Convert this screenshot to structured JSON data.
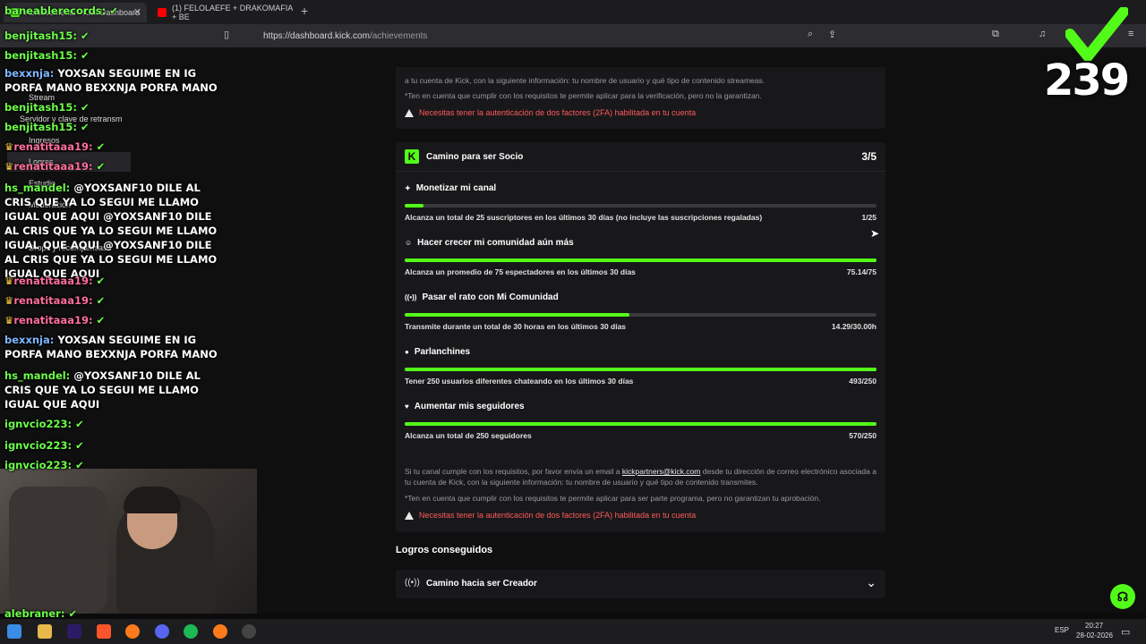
{
  "browser": {
    "tabs": [
      {
        "label": "Achievements - Kick Dashboard"
      },
      {
        "label": "(1) FELOLAEFE + DRAKOMAFIA + BE"
      }
    ],
    "url_host": "https://dashboard.kick.com",
    "url_path": "/achievements",
    "new_tab": "+"
  },
  "sidebar": {
    "items": [
      {
        "label": "Stream"
      },
      {
        "label": "Servidor y clave de retransm"
      },
      {
        "label": "Ingresos"
      },
      {
        "label": "Logros"
      },
      {
        "label": "Estudio"
      },
      {
        "label": "Moderación"
      },
      {
        "label": "Drops y recompensas"
      }
    ]
  },
  "top_card": {
    "text_partial": "a tu cuenta de Kick, con la siguiente información: tu nombre de usuario y qué tipo de contenido streameas.",
    "note": "*Ten en cuenta que cumplir con los requisitos te permite aplicar para la verificación, pero no la garantizan.",
    "warning": "Necesitas tener la autenticación de dos factores (2FA) habilitada en tu cuenta"
  },
  "partner_card": {
    "title": "Camino para ser Socio",
    "progress": "3/5",
    "requirements": [
      {
        "title": "Monetizar mi canal",
        "icon": "sparkle-icon",
        "description": "Alcanza un total de 25 suscriptores en los últimos 30 días (no incluye las suscripciones regaladas)",
        "value": "1/25",
        "fraction": 0.04
      },
      {
        "title": "Hacer crecer mi comunidad aún más",
        "icon": "community-icon",
        "description": "Alcanza un promedio de 75 espectadores en los últimos 30 días",
        "value": "75.14/75",
        "fraction": 1.0
      },
      {
        "title": "Pasar el rato con Mi Comunidad",
        "icon": "broadcast-icon",
        "description": "Transmite durante un total de 30 horas en los últimos 30 días",
        "value": "14.29/30.00h",
        "fraction": 0.476
      },
      {
        "title": "Parlanchines",
        "icon": "chat-bubble-icon",
        "description": "Tener 250 usuarios diferentes chateando en los últimos 30 días",
        "value": "493/250",
        "fraction": 1.0
      },
      {
        "title": "Aumentar mis seguidores",
        "icon": "heart-icon",
        "description": "Alcanza un total de 250 seguidores",
        "value": "570/250",
        "fraction": 1.0
      }
    ],
    "info_prefix": "Si tu canal cumple con los requisitos, por favor envía un email a ",
    "info_email": "kickpartners@kick.com",
    "info_suffix": " desde tu dirección de correo electrónico asociada a tu cuenta de Kick, con la siguiente información: tu nombre de usuario y qué tipo de contenido transmites.",
    "note": "*Ten en cuenta que cumplir con los requisitos te permite aplicar para ser parte programa, pero no garantizan tu aprobación.",
    "warning": "Necesitas tener la autenticación de dos factores (2FA) habilitada en tu cuenta"
  },
  "achieved": {
    "heading": "Logros conseguidos",
    "item": "Camino hacia ser Creador"
  },
  "chat": [
    {
      "user": "baneablerecords:",
      "msg": "",
      "color": "green"
    },
    {
      "user": "benjitash15:",
      "msg": "",
      "color": "green"
    },
    {
      "user": "benjitash15:",
      "msg": "",
      "color": "green"
    },
    {
      "user": "bexxnja:",
      "msg": "YOXSAN SEGUIME EN IG PORFA MANO BEXXNJA PORFA MANO",
      "color": "blue"
    },
    {
      "user": "benjitash15:",
      "msg": "",
      "color": "green"
    },
    {
      "user": "benjitash15:",
      "msg": "",
      "color": "green"
    },
    {
      "user": "renatitaaa19:",
      "msg": "",
      "color": "pink"
    },
    {
      "user": "renatitaaa19:",
      "msg": "",
      "color": "pink"
    },
    {
      "user": "hs_mandel:",
      "msg": "@YOXSANF10 DILE AL CRIS QUE YA LO SEGUI ME LLAMO IGUAL QUE AQUI @YOXSANF10 DILE AL CRIS QUE YA LO SEGUI ME LLAMO IGUAL QUE AQUI @YOXSANF10 DILE AL CRIS QUE YA LO SEGUI ME LLAMO IGUAL QUE AQUI",
      "color": "green"
    },
    {
      "user": "renatitaaa19:",
      "msg": "",
      "color": "pink"
    },
    {
      "user": "renatitaaa19:",
      "msg": "",
      "color": "pink"
    },
    {
      "user": "renatitaaa19:",
      "msg": "",
      "color": "pink"
    },
    {
      "user": "bexxnja:",
      "msg": "YOXSAN SEGUIME EN IG PORFA MANO BEXXNJA PORFA MANO",
      "color": "blue"
    },
    {
      "user": "hs_mandel:",
      "msg": "@YOXSANF10 DILE AL CRIS QUE YA LO SEGUI ME LLAMO IGUAL QUE AQUI",
      "color": "green"
    },
    {
      "user": "ignvcio223:",
      "msg": "",
      "color": "green"
    },
    {
      "user": "ignvcio223:",
      "msg": "",
      "color": "green"
    },
    {
      "user": "ignvcio223:",
      "msg": "",
      "color": "green"
    },
    {
      "user": "alebraner:",
      "msg": "",
      "color": "green"
    }
  ],
  "overlay": {
    "big_number": "239"
  },
  "taskbar": {
    "lang": "ESP",
    "time": "20:27",
    "date": "28-02-2026"
  },
  "colors": {
    "accent": "#53fc18",
    "warning": "#ff5a5a",
    "card_bg": "#18181b"
  }
}
